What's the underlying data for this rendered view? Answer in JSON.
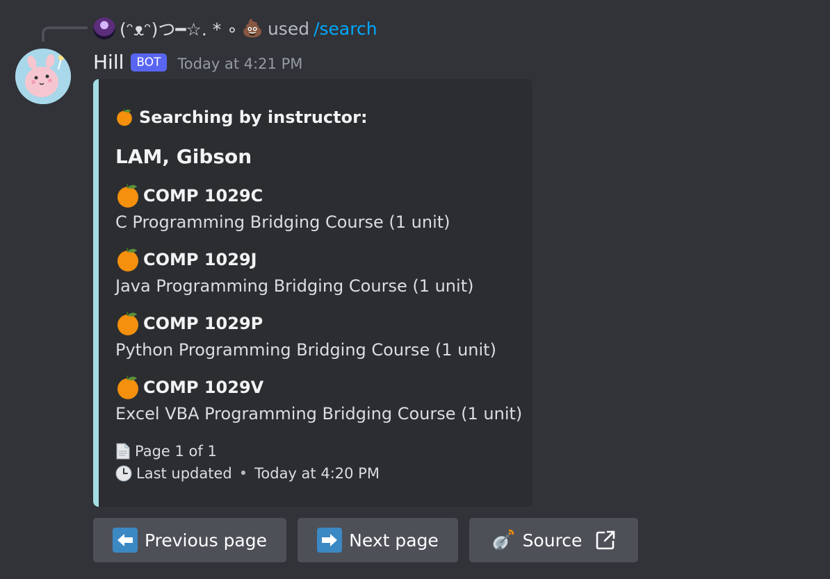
{
  "reply": {
    "username": "(ᵔ⁠ᴥ⁠ᵔ)つ━☆. * ∘",
    "used_text": "used",
    "command": "/search"
  },
  "message": {
    "author": "Hill",
    "badge": "BOT",
    "timestamp": "Today at 4:21 PM"
  },
  "embed": {
    "accent_color": "#a3dde3",
    "author_text": "Searching by instructor:",
    "title": "LAM, Gibson",
    "fields": [
      {
        "name": "COMP 1029C",
        "value": "C Programming Bridging Course (1 unit)",
        "icon": "orange-icon"
      },
      {
        "name": "COMP 1029J",
        "value": "Java Programming Bridging Course (1 unit)",
        "icon": "orange-icon"
      },
      {
        "name": "COMP 1029P",
        "value": "Python Programming Bridging Course (1 unit)",
        "icon": "orange-icon"
      },
      {
        "name": "COMP 1029V",
        "value": "Excel VBA Programming Bridging Course (1 unit)",
        "icon": "orange-icon"
      }
    ],
    "footer": {
      "page_text": "Page 1 of 1",
      "updated_text": "Last updated",
      "separator": "•",
      "updated_time": "Today at 4:20 PM"
    }
  },
  "buttons": {
    "previous_label": "Previous page",
    "next_label": "Next page",
    "source_label": "Source"
  },
  "colors": {
    "background": "#313338",
    "embed_background": "#2b2d31",
    "button": "#4e5058",
    "badge": "#5865f2",
    "link": "#00a8fc"
  }
}
